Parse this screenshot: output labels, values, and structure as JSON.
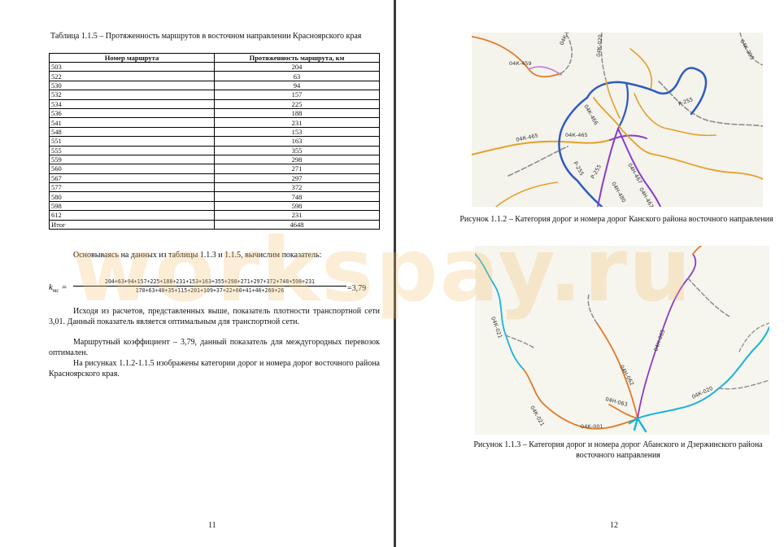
{
  "left_page": {
    "table_caption": "Таблица 1.1.5 – Протяженность маршрутов в восточном направлении Красноярского края",
    "table": {
      "headers": [
        "Номер маршрута",
        "Протяженность маршрута, км"
      ],
      "rows": [
        [
          "503",
          "204"
        ],
        [
          "522",
          "63"
        ],
        [
          "530",
          "94"
        ],
        [
          "532",
          "157"
        ],
        [
          "534",
          "225"
        ],
        [
          "536",
          "188"
        ],
        [
          "541",
          "231"
        ],
        [
          "548",
          "153"
        ],
        [
          "551",
          "163"
        ],
        [
          "555",
          "355"
        ],
        [
          "559",
          "298"
        ],
        [
          "560",
          "271"
        ],
        [
          "567",
          "297"
        ],
        [
          "577",
          "372"
        ],
        [
          "580",
          "748"
        ],
        [
          "598",
          "598"
        ],
        [
          "612",
          "231"
        ]
      ],
      "total": [
        "Итог",
        "4648"
      ]
    },
    "intro": "Основываясь на данных из таблицы 1.1.3 и 1.1.5, вычислим показатель:",
    "formula": {
      "symbol": "k",
      "subscript": "мс",
      "numerator": "204+63+94+157+225+188+231+153+163+355+298+271+297+372+748+598+231",
      "denominator": "170+63+40+35+115+201+109+37+22+60+41+46+260+26",
      "result": "=3,79"
    },
    "para1": "Исходя из расчетов, представленных выше, показатель плотности транспортной сети 3,01. Данный показатель является оптимальным для транспортной сети.",
    "para2": "Маршрутный коэффициент – 3,79, данный показатель для междугородных перевозок оптимален.",
    "para3": "На рисунках 1.1.2-1.1.5 изображены категории дорог и номера дорог восточного района Красноярского края.",
    "page_number": "11"
  },
  "right_page": {
    "figure1": {
      "caption": "Рисунок 1.1.2 – Категория дорог и номера дорог Канского района восточного направления",
      "labels": [
        "04К-459",
        "04К-021",
        "04К-020",
        "04К-395",
        "Р-255",
        "04К-466",
        "04К-465",
        "04К-465",
        "Р-255",
        "Р-255",
        "04Н-467",
        "04Н-480",
        "04Н-467"
      ]
    },
    "figure2": {
      "caption": "Рисунок 1.1.3 – Категория дорог и номера дорог Абанского и Дзержинского района восточного направления",
      "labels": [
        "04К-021",
        "04Н-065",
        "04Н-062",
        "04Н-063",
        "04К-020",
        "04К-021",
        "04К-001"
      ]
    },
    "page_number": "12"
  },
  "watermark": "workspay.ru",
  "colors": {
    "federal_road": "#2e5bbf",
    "regional_road": "#e3a12a",
    "purple_road": "#8a3cc8",
    "orange_road": "#e07a2a",
    "cyan_road": "#19b4d8",
    "grey_road": "#8c8c8c"
  }
}
